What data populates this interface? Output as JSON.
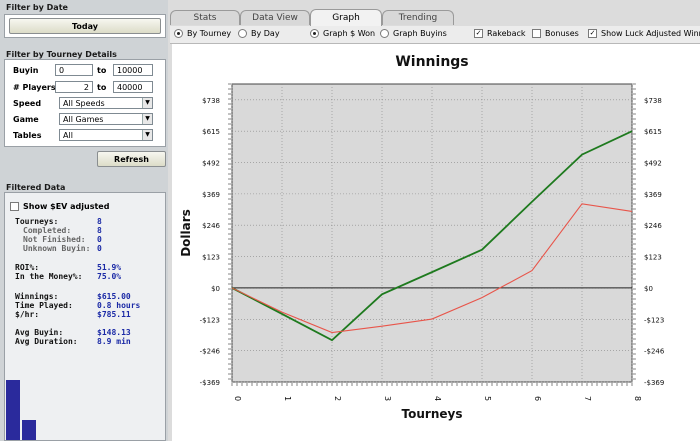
{
  "filter_date": {
    "title": "Filter by Date",
    "today_button": "Today"
  },
  "filter_tourney": {
    "title": "Filter by Tourney Details",
    "buyin": {
      "label": "Buyin",
      "min": "0",
      "to": "to",
      "max": "10000"
    },
    "players": {
      "label": "# Players",
      "min": "2",
      "to": "to",
      "max": "40000"
    },
    "speed": {
      "label": "Speed",
      "value": "All Speeds"
    },
    "game": {
      "label": "Game",
      "value": "All Games"
    },
    "tables": {
      "label": "Tables",
      "value": "All"
    },
    "refresh_button": "Refresh"
  },
  "filtered_data": {
    "title": "Filtered Data",
    "show_ev_label": "Show $EV adjusted",
    "stats": [
      {
        "label": "Tourneys:",
        "value": "8",
        "sub": false
      },
      {
        "label": "Completed:",
        "value": "8",
        "sub": true
      },
      {
        "label": "Not Finished:",
        "value": "0",
        "sub": true
      },
      {
        "label": "Unknown Buyin:",
        "value": "0",
        "sub": true
      },
      {
        "label": "ROI%:",
        "value": "51.9%",
        "sub": false
      },
      {
        "label": "In the Money%:",
        "value": "75.0%",
        "sub": false
      },
      {
        "label": "Winnings:",
        "value": "$615.00",
        "sub": false
      },
      {
        "label": "Time Played:",
        "value": "0.8 hours",
        "sub": false
      },
      {
        "label": "$/hr:",
        "value": "$785.11",
        "sub": false
      },
      {
        "label": "Avg Buyin:",
        "value": "$148.13",
        "sub": false
      },
      {
        "label": "Avg Duration:",
        "value": "8.9 min",
        "sub": false
      }
    ],
    "mini_bars": [
      0.75,
      0.25
    ],
    "mini_bar_color": "#2a2a9c"
  },
  "tabs": [
    {
      "label": "Stats",
      "active": false
    },
    {
      "label": "Data View",
      "active": false
    },
    {
      "label": "Graph",
      "active": true
    },
    {
      "label": "Trending",
      "active": false
    }
  ],
  "options": {
    "by_tourney": "By Tourney",
    "by_day": "By Day",
    "graph_won": "Graph $ Won",
    "graph_buyins": "Graph Buyins",
    "rakeback": "Rakeback",
    "bonuses": "Bonuses",
    "show_luck": "Show Luck Adjusted Winn",
    "rakeback_checked": true,
    "bonuses_checked": false,
    "show_luck_checked": true
  },
  "chart_data": {
    "type": "line",
    "title": "Winnings",
    "xlabel": "Tourneys",
    "ylabel": "Dollars",
    "x": [
      0,
      1,
      2,
      3,
      4,
      5,
      6,
      7,
      8
    ],
    "y_ticks": [
      "$738",
      "$615",
      "$492",
      "$369",
      "$246",
      "$123",
      "$0",
      "-$123",
      "-$246",
      "-$369"
    ],
    "y_tick_values": [
      738,
      615,
      492,
      369,
      246,
      123,
      0,
      -123,
      -246,
      -369
    ],
    "ylim": [
      -369,
      800
    ],
    "grid": true,
    "series": [
      {
        "color": "#1e7a1e",
        "values": [
          0,
          -102,
          -205,
          -25,
          62,
          150,
          338,
          523,
          615
        ]
      },
      {
        "color": "#e8554a",
        "values": [
          0,
          -95,
          -175,
          -150,
          -122,
          -38,
          68,
          330,
          300
        ]
      }
    ],
    "plot_bg": "#d9d9d9"
  }
}
